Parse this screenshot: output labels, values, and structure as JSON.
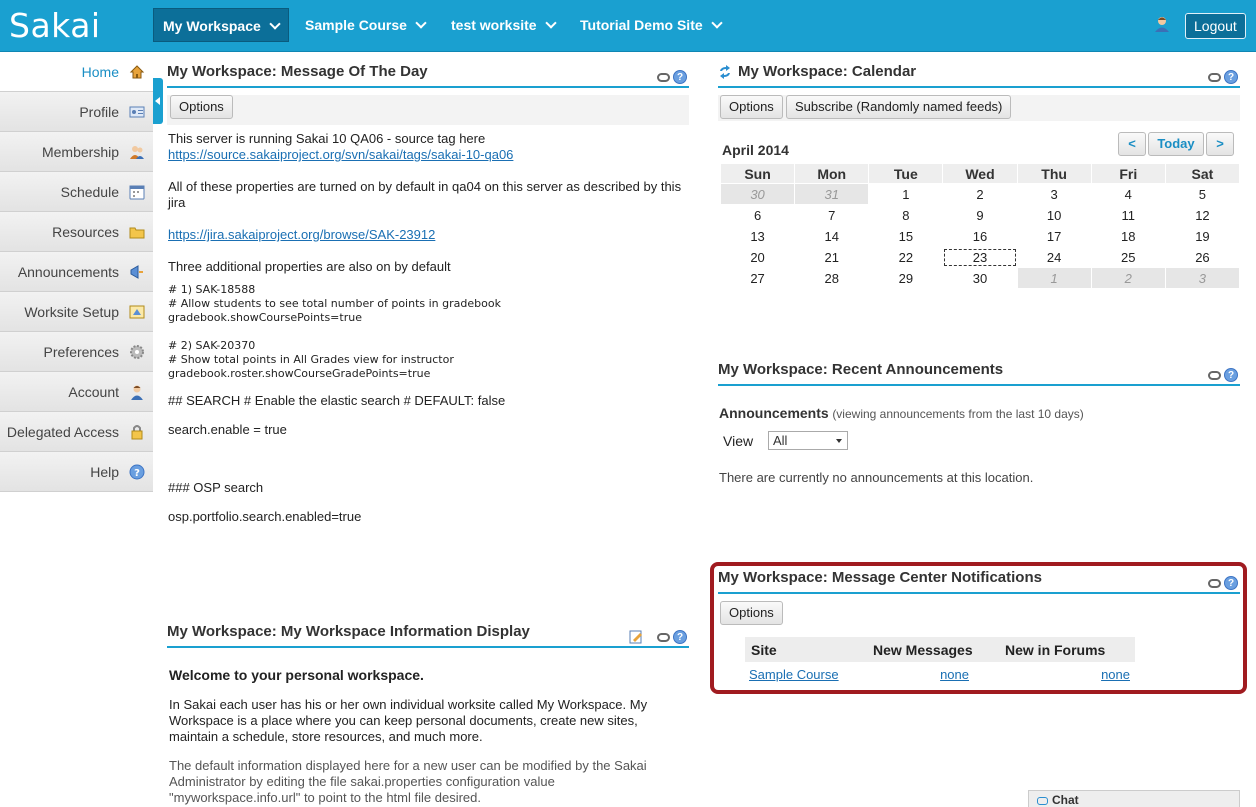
{
  "header": {
    "logo": "Sakai",
    "tabs": [
      "My Workspace",
      "Sample Course",
      "test worksite",
      "Tutorial Demo Site"
    ],
    "logout": "Logout"
  },
  "toolmenu": {
    "items": [
      "Home",
      "Profile",
      "Membership",
      "Schedule",
      "Resources",
      "Announcements",
      "Worksite Setup",
      "Preferences",
      "Account",
      "Delegated Access",
      "Help"
    ]
  },
  "motd": {
    "title": "My Workspace: Message Of The Day",
    "options": "Options",
    "line1": "This server is running Sakai 10 QA06 - source tag here",
    "link1": "https://source.sakaiproject.org/svn/sakai/tags/sakai-10-qa06",
    "line2": "All of these properties are turned on by default in qa04 on this server as described by this jira",
    "link2": "https://jira.sakaiproject.org/browse/SAK-23912",
    "line3": "Three additional properties are also on by default",
    "code1a": "# 1) SAK-18588",
    "code1b": "# Allow students to see total number of points in gradebook",
    "code1c": "gradebook.showCoursePoints=true",
    "code2a": "# 2) SAK-20370",
    "code2b": "# Show total points in All Grades view for instructor",
    "code2c": "gradebook.roster.showCourseGradePoints=true",
    "line4": "## SEARCH # Enable the elastic search # DEFAULT: false",
    "line5": "search.enable = true",
    "line6": "### OSP search",
    "line7": "osp.portfolio.search.enabled=true"
  },
  "info": {
    "title": "My Workspace: My Workspace Information Display",
    "welcome": "Welcome to your personal workspace.",
    "para1": "In Sakai each user has his or her own individual worksite called My Workspace. My Workspace is a place where you can keep personal documents, create new sites, maintain a schedule, store resources, and much more.",
    "para2": "The default information displayed here for a new user can be modified by the Sakai Administrator by editing the file sakai.properties configuration value \"myworkspace.info.url\" to point to the html file desired."
  },
  "calendar": {
    "title": "My Workspace: Calendar",
    "options": "Options",
    "subscribe": "Subscribe (Randomly named feeds)",
    "month": "April 2014",
    "prev": "<",
    "today": "Today",
    "next": ">",
    "days": [
      "Sun",
      "Mon",
      "Tue",
      "Wed",
      "Thu",
      "Fri",
      "Sat"
    ],
    "weeks": [
      [
        "30",
        "31",
        "1",
        "2",
        "3",
        "4",
        "5"
      ],
      [
        "6",
        "7",
        "8",
        "9",
        "10",
        "11",
        "12"
      ],
      [
        "13",
        "14",
        "15",
        "16",
        "17",
        "18",
        "19"
      ],
      [
        "20",
        "21",
        "22",
        "23",
        "24",
        "25",
        "26"
      ],
      [
        "27",
        "28",
        "29",
        "30",
        "1",
        "2",
        "3"
      ]
    ]
  },
  "announcements": {
    "title": "My Workspace: Recent Announcements",
    "heading": "Announcements",
    "subheading": "(viewing announcements from the last 10 days)",
    "view_label": "View",
    "view_value": "All",
    "empty": "There are currently no announcements at this location."
  },
  "mc": {
    "title": "My Workspace: Message Center Notifications",
    "options": "Options",
    "col_site": "Site",
    "col_new": "New Messages",
    "col_forums": "New in Forums",
    "row_site": "Sample Course",
    "row_new": "none",
    "row_forums": "none"
  },
  "chat": {
    "label": "Chat"
  }
}
